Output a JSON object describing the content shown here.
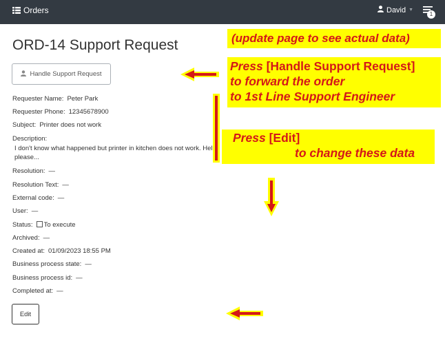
{
  "navbar": {
    "brand_label": "Orders",
    "brand_icon": "list-icon",
    "user_name": "David",
    "user_icon": "user-icon",
    "notifications_count": "1",
    "notifications_icon": "notifications-icon"
  },
  "page": {
    "title": "ORD-14 Support Request",
    "handle_button_label": "Handle Support Request",
    "edit_button_label": "Edit"
  },
  "fields": {
    "requester_name": {
      "label": "Requester Name:",
      "value": "Peter Park"
    },
    "requester_phone": {
      "label": "Requester Phone:",
      "value": "12345678900"
    },
    "subject": {
      "label": "Subject:",
      "value": "Printer does not work"
    },
    "description": {
      "label": "Description:",
      "value": "I don't know what happened but printer in kitchen does not work. Help, please..."
    },
    "resolution": {
      "label": "Resolution:",
      "value": "—"
    },
    "resolution_text": {
      "label": "Resolution Text:",
      "value": "—"
    },
    "external_code": {
      "label": "External code:",
      "value": "—"
    },
    "user": {
      "label": "User:",
      "value": "—"
    },
    "status": {
      "label": "Status:",
      "value": "To execute"
    },
    "archived": {
      "label": "Archived:",
      "value": "—"
    },
    "created_at": {
      "label": "Created at:",
      "value": "01/09/2023 18:55 PM"
    },
    "business_process_state": {
      "label": "Business process state:",
      "value": "—"
    },
    "business_process_id": {
      "label": "Business process id:",
      "value": "—"
    },
    "completed_at": {
      "label": "Completed at:",
      "value": "—"
    }
  },
  "annotations": {
    "update_note": "(update page to see actual data)",
    "handle_note": {
      "press": "Press",
      "button": "[Handle Support Request]",
      "line2": "to forward the order",
      "line3": "to 1st Line Support Engineer"
    },
    "edit_note": {
      "press": "Press",
      "button": "[Edit]",
      "line2": "to change these data"
    },
    "highlight_color": "#ffff00",
    "text_color": "#d41818"
  }
}
